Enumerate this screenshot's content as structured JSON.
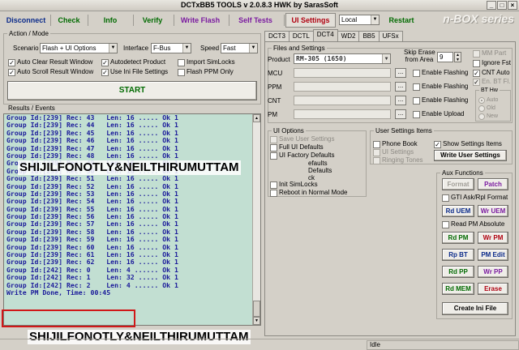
{
  "window": {
    "title": "DCTxBB5 TOOLS v 2.0.8.3 HWK by SarasSoft",
    "brand": "n-BOX series"
  },
  "toolbar": {
    "disconnect": "Disconnect",
    "check": "Check",
    "info": "Info",
    "verify": "Verify",
    "write_flash": "Write Flash",
    "self_tests": "Self Tests",
    "user_settings": "UI Settings",
    "local": "Local",
    "restart": "Restart"
  },
  "action": {
    "legend": "Action / Mode",
    "scenario_label": "Scenario",
    "scenario_value": "Flash + UI Options",
    "interface_label": "Interface",
    "interface_value": "F-Bus",
    "speed_label": "Speed",
    "speed_value": "Fast",
    "auto_clear": "Auto Clear Result Window",
    "autodetect": "Autodetect Product",
    "import_simlocks": "Import SimLocks",
    "auto_scroll": "Auto Scroll Result Window",
    "use_ini": "Use Ini File Settings",
    "flash_ppm": "Flash PPM Only",
    "start": "START"
  },
  "results": {
    "legend": "Results / Events",
    "rows": [
      "Group Id:[239] Rec: 43   Len: 16 ..... Ok 1",
      "Group Id:[239] Rec: 44   Len: 16 ..... Ok 1",
      "Group Id:[239] Rec: 45   Len: 16 ..... Ok 1",
      "Group Id:[239] Rec: 46   Len: 16 ..... Ok 1",
      "Group Id:[239] Rec: 47   Len: 16 ..... Ok 1",
      "Group Id:[239] Rec: 48   Len: 16 ..... Ok 1",
      "Group Id:[239] Rec: 49   Len: 16 ..... Ok 1",
      "Group Id:[239] Rec: 50   Len: 16 ..... Ok 1",
      "Group Id:[239] Rec: 51   Len: 16 ..... Ok 1",
      "Group Id:[239] Rec: 52   Len: 16 ..... Ok 1",
      "Group Id:[239] Rec: 53   Len: 16 ..... Ok 1",
      "Group Id:[239] Rec: 54   Len: 16 ..... Ok 1",
      "Group Id:[239] Rec: 55   Len: 16 ..... Ok 1",
      "Group Id:[239] Rec: 56   Len: 16 ..... Ok 1",
      "Group Id:[239] Rec: 57   Len: 16 ..... Ok 1",
      "Group Id:[239] Rec: 58   Len: 16 ..... Ok 1",
      "Group Id:[239] Rec: 59   Len: 16 ..... Ok 1",
      "Group Id:[239] Rec: 60   Len: 16 ..... Ok 1",
      "Group Id:[239] Rec: 61   Len: 16 ..... Ok 1",
      "Group Id:[239] Rec: 62   Len: 16 ..... Ok 1",
      "Group Id:[242] Rec: 0    Len: 4 ...... Ok 1",
      "Group Id:[242] Rec: 1    Len: 32 ..... Ok 1",
      "Group Id:[242] Rec: 2    Len: 4 ...... Ok 1",
      "Write PM Done, Time: 00:45"
    ]
  },
  "tabs": [
    "DCT3",
    "DCTL",
    "DCT4",
    "WD2",
    "BB5",
    "UFSx"
  ],
  "files": {
    "legend": "Files and Settings",
    "product_label": "Product",
    "product_value": "RM-305  (1650)",
    "skip_erase_label": "Skip Erase\nfrom Area",
    "skip_value": "9",
    "mm_part": "MM Part",
    "ignore_fst": "Ignore Fst",
    "cnt_auto": "CNT Auto",
    "en_bt_fl": "En. BT Fl.",
    "mcu_label": "MCU",
    "ppm_label": "PPM",
    "cnt_label": "CNT",
    "pm_label": "PM",
    "dots": "...",
    "enable_flashing": "Enable Flashing",
    "enable_upload": "Enable Upload",
    "bt_hw_label": "BT Hw",
    "bt_auto": "Auto",
    "bt_old": "Old",
    "bt_new": "New"
  },
  "ui_options": {
    "legend": "UI Options",
    "save_user": "Save User Settings",
    "full_ui": "Full UI Defaults",
    "ui_factory": "UI Factory Defaults",
    "defaults": "efaults",
    "defaults2": "Defaults",
    "ck": "ck",
    "init_simlocks": "Init SimLocks",
    "reboot_normal": "Reboot in Normal Mode"
  },
  "user_items": {
    "legend": "User Settings Items",
    "phone_book": "Phone Book",
    "ui_settings": "UI Settings",
    "ringing_tones": "Ringing Tones",
    "show_settings": "Show Settings Items",
    "write_user": "Write User Settings"
  },
  "aux": {
    "legend": "Aux Functions",
    "format": "Format",
    "patch": "Patch",
    "gti": "GTI Ask/Rpl Format",
    "rd_uem": "Rd UEM",
    "wr_uem": "Wr UEM",
    "read_pm_abs": "Read PM Absolute",
    "rd_pm": "Rd PM",
    "wr_pm": "Wr PM",
    "rp_bt": "Rp BT",
    "pm_edit": "PM Edit",
    "rd_pp": "Rd PP",
    "wr_pp": "Wr PP",
    "rd_mem": "Rd MEM",
    "erase": "Erase",
    "create_ini": "Create Ini File"
  },
  "watermark": "SHIJILFONOTLY&NEILTHIRUMUTTAM",
  "status": {
    "state": "Idle"
  }
}
